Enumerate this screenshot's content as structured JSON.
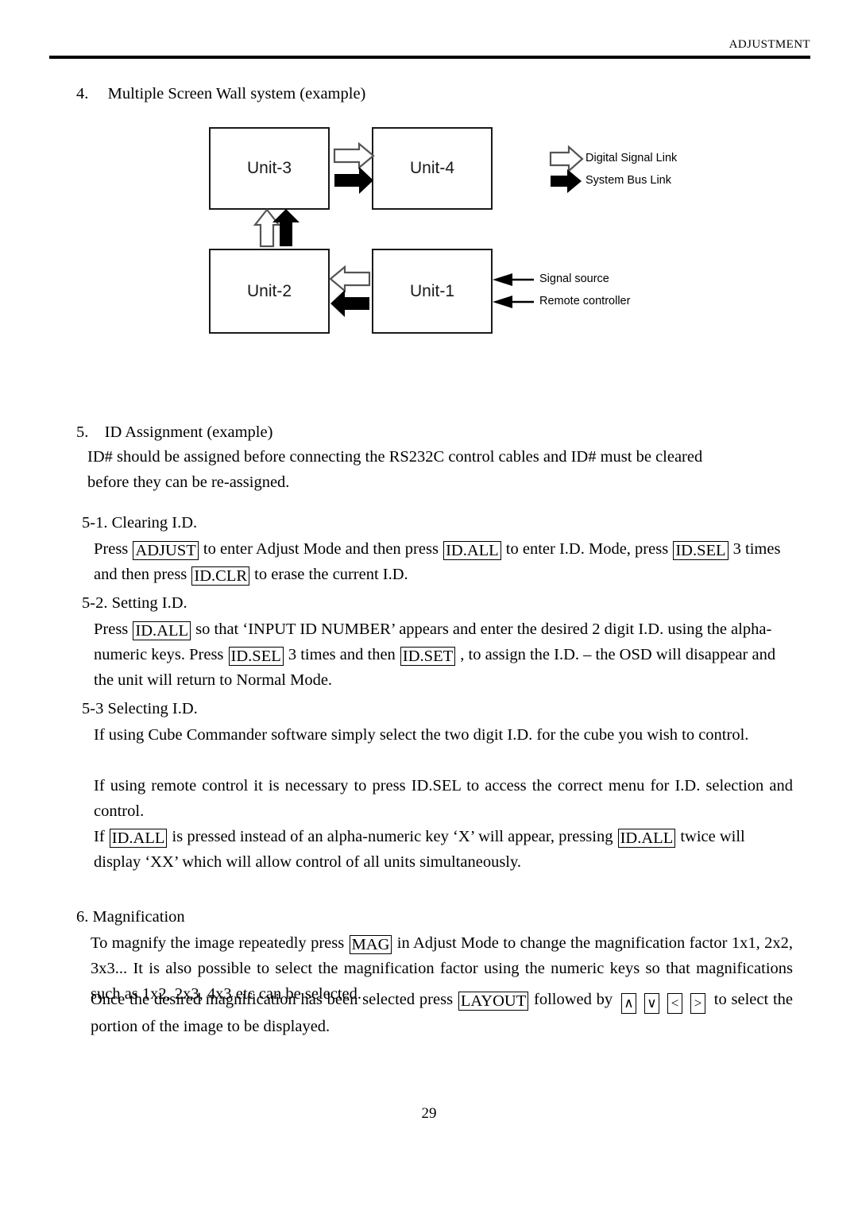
{
  "header": {
    "title": "ADJUSTMENT"
  },
  "sections": {
    "s4": {
      "number": "4.",
      "title": "Multiple Screen Wall system (example)"
    },
    "s5": {
      "number": "5.",
      "title": "ID Assignment (example)",
      "body_line1": "ID# should be assigned before connecting the RS232C control cables and ID# must be cleared",
      "body_line2": "before they can be re-assigned."
    },
    "s51": {
      "title": "5-1. Clearing I.D.",
      "t1": "Press ",
      "k1": "ADJUST",
      "t2": " to enter Adjust Mode and then press ",
      "k2": "ID.ALL",
      "t3": " to enter I.D. Mode, press ",
      "k3": "ID.SEL",
      "t4": " 3 times and then press ",
      "k4": "ID.CLR",
      "t5": " to erase the current I.D."
    },
    "s52": {
      "title": "5-2. Setting I.D.",
      "t1": "Press ",
      "k1": "ID.ALL",
      "t2": " so that ‘INPUT ID NUMBER’ appears and enter the desired 2 digit I.D. using the alpha-numeric keys. Press ",
      "k2": "ID.SEL",
      "t3": " 3 times and then ",
      "k3": "ID.SET",
      "t4": " , to assign the I.D. – the OSD will disappear and the unit will return to Normal Mode."
    },
    "s53": {
      "title": "5-3 Selecting I.D.",
      "p1": "If using Cube Commander software simply select the two digit I.D. for the cube you wish to control.",
      "p2": "If using remote control it is necessary to press ID.SEL to access the correct menu for I.D. selection and control.",
      "p3_t1": "If ",
      "p3_k1": "ID.ALL",
      "p3_t2": " is pressed instead of an alpha-numeric key ‘X’ will appear, pressing ",
      "p3_k2": "ID.ALL",
      "p3_t3": " twice will display ‘XX’ which will allow control of all units simultaneously."
    },
    "s6": {
      "title": "6. Magnification",
      "p1_t1": "To magnify the image repeatedly press ",
      "p1_k1": "MAG",
      "p1_t2": " in Adjust Mode to change the magnification factor 1x1, 2x2, 3x3... It is also possible to select the magnification factor using the numeric keys so that magnifications such as 1x2, 2x3, 4x3 etc can be selected.",
      "p2_t1": "Once the desired magnification has been selected press ",
      "p2_k1": "LAYOUT",
      "p2_t2": " followed by ",
      "p2_k_up": "∧",
      "p2_k_down": "∨",
      "p2_k_left": "<",
      "p2_k_right": ">",
      "p2_t3": " to select the portion of the image to be displayed."
    }
  },
  "diagram": {
    "units": [
      {
        "id": "unit3",
        "label": "Unit-3"
      },
      {
        "id": "unit4",
        "label": "Unit-4"
      },
      {
        "id": "unit2",
        "label": "Unit-2"
      },
      {
        "id": "unit1",
        "label": "Unit-1"
      }
    ],
    "legend": {
      "digital": "Digital Signal Link",
      "bus": "System Bus Link"
    },
    "inputs": {
      "signal_source": "Signal source",
      "remote_controller": "Remote controller"
    },
    "colors": {
      "outline": "#1a1a1a",
      "fill_hollow": "#ffffff",
      "fill_solid": "#000000"
    }
  },
  "footer": {
    "page_number": "29"
  }
}
